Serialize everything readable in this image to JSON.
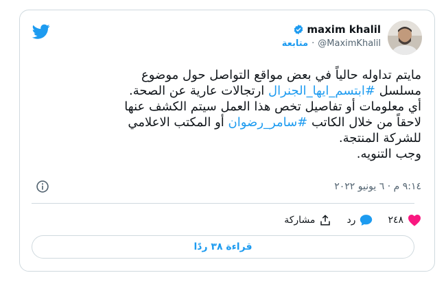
{
  "user": {
    "name": "maxim khalil",
    "handle": "@MaximKhalil",
    "separator": "·",
    "follow_label": "متابعة"
  },
  "tweet": {
    "lines": [
      "مايتم تداوله حالياً في بعض مواقع التواصل حول موضوع",
      "ارتجالات عارية عن الصحة.",
      " أي معلومات أو تفاصيل تخص هذا العمل سيتم الكشف عنها",
      "أو المكتب الاعلامي",
      "للشركة المنتجة.",
      " وجب التنويه."
    ],
    "line2_prefix": "مسلسل ",
    "hashtag1": "#ابتسم_ايها_الجنرال",
    "line4_prefix": "لاحقاً من خلال الكاتب ",
    "hashtag2": "#سامر_رضوان"
  },
  "meta": {
    "timestamp": "٩:١٤ م · ٦ يونيو ٢٠٢٢"
  },
  "actions": {
    "like_count": "٢٤٨",
    "reply_label": "رد",
    "share_label": "مشاركة"
  },
  "read_replies": "قراءة ٣٨ ردًا",
  "icons": {
    "bird": "twitter-bird-icon",
    "verified": "verified-badge-icon",
    "info": "info-icon",
    "heart": "heart-icon",
    "reply": "reply-bubble-icon",
    "share": "share-icon"
  },
  "colors": {
    "accent": "#1d9bf0",
    "like": "#f91880",
    "text": "#0f1419",
    "muted": "#536471",
    "border": "#cfd9de"
  }
}
